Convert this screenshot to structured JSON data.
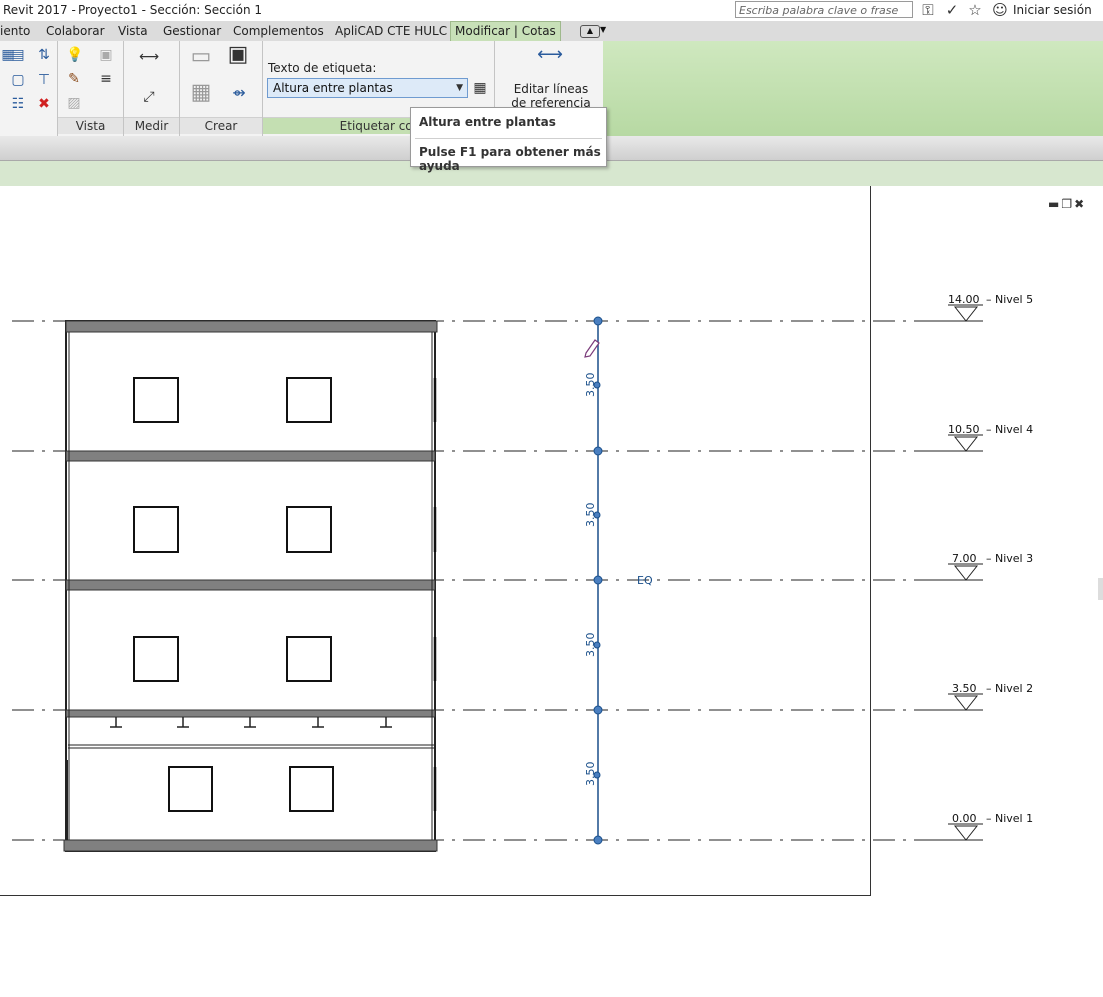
{
  "titlebar": {
    "app_title": "Revit 2017 -",
    "doc_title": "Proyecto1 - Sección: Sección 1",
    "search_placeholder": "Escriba palabra clave o frase",
    "sign_in": "Iniciar sesión"
  },
  "tabs": [
    "iento",
    "Colaborar",
    "Vista",
    "Gestionar",
    "Complementos",
    "ApliCAD CTE HULC",
    "Modificar | Cotas"
  ],
  "ribbon": {
    "panels": {
      "vista": "Vista",
      "medir": "Medir",
      "crear": "Crear",
      "etiquetar": "Etiquetar cot"
    },
    "label_caption": "Texto de etiqueta:",
    "label_value": "Altura entre plantas",
    "edit_button": "Editar líneas de referencia"
  },
  "tooltip": {
    "title": "Altura entre plantas",
    "help": "Pulse F1 para obtener más ayuda"
  },
  "drawing": {
    "dimension_labels": [
      "3.50",
      "3.50",
      "3.50",
      "3.50"
    ],
    "eq_label": "EQ",
    "levels": [
      {
        "elevation": "14.00",
        "name": "Nivel 5"
      },
      {
        "elevation": "10.50",
        "name": "Nivel 4"
      },
      {
        "elevation": "7.00",
        "name": "Nivel 3"
      },
      {
        "elevation": "3.50",
        "name": "Nivel 2"
      },
      {
        "elevation": "0.00",
        "name": "Nivel 1"
      }
    ],
    "colors": {
      "dimension": "#1a4f8a",
      "slab": "#808080",
      "ribbon_active": "#c8e0b8"
    }
  }
}
